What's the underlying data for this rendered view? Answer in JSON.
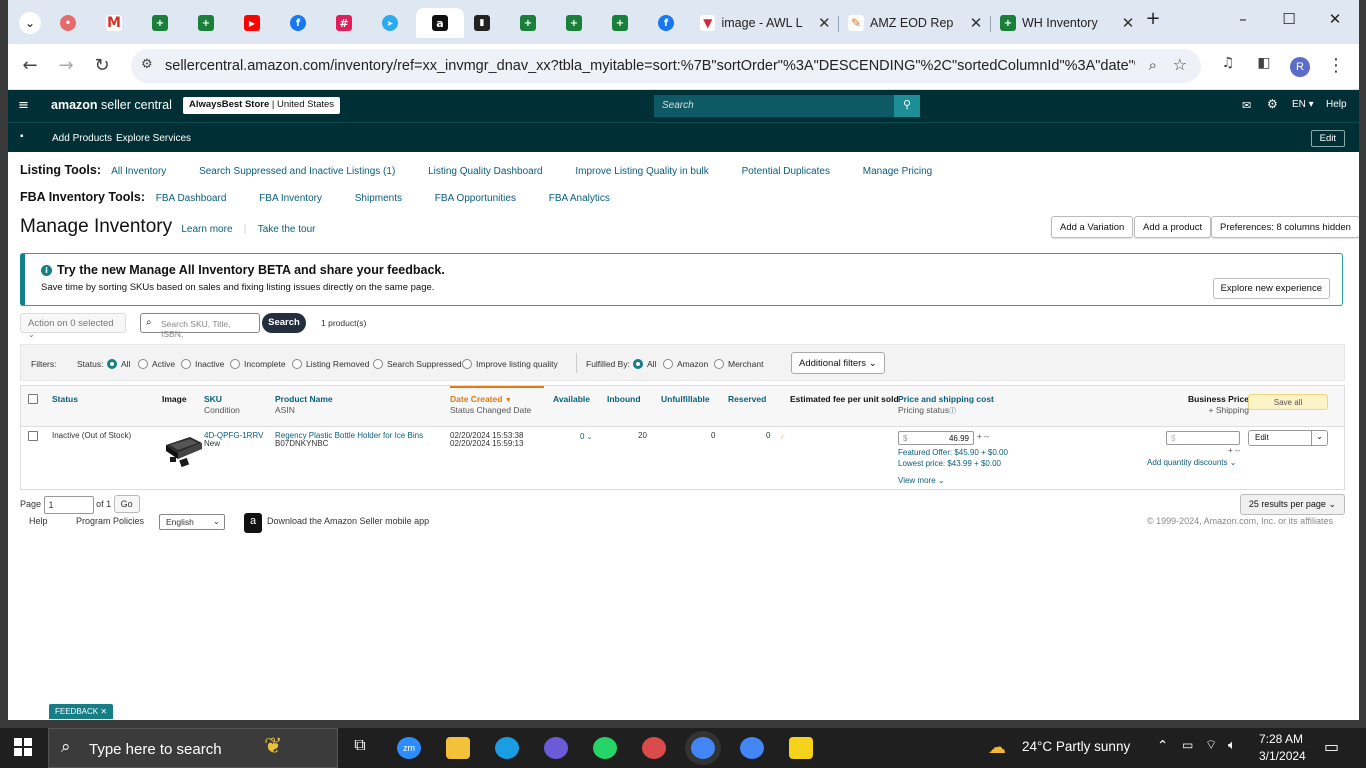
{
  "browser": {
    "tabs": [
      {
        "label": "image - AWL L",
        "close": "✕"
      },
      {
        "label": "AMZ EOD Rep",
        "close": "✕"
      },
      {
        "label": "WH Inventory",
        "close": "✕"
      }
    ],
    "new_tab": "+",
    "url": "sellercentral.amazon.com/inventory/ref=xx_invmgr_dnav_xx?tbla_myitable=sort:%7B\"sortOrder\"%3A\"DESCENDING\"%2C\"sortedColumnId\"%3A\"date\"%7D;s...",
    "profile_initial": "R"
  },
  "header": {
    "logo_bold": "amazon",
    "logo_rest": " seller central",
    "store": "AlwaysBest Store",
    "region": "United States",
    "search_placeholder": "Search",
    "lang": "EN ▾",
    "help": "Help",
    "nav": [
      "Add Products",
      "Explore Services"
    ],
    "edit": "Edit"
  },
  "listing_tools": {
    "label": "Listing Tools:",
    "links": [
      "All Inventory",
      "Search Suppressed and Inactive Listings (1)",
      "Listing Quality Dashboard",
      "Improve Listing Quality in bulk",
      "Potential Duplicates",
      "Manage Pricing"
    ]
  },
  "fba_tools": {
    "label": "FBA Inventory Tools:",
    "links": [
      "FBA Dashboard",
      "FBA Inventory",
      "Shipments",
      "FBA Opportunities",
      "FBA Analytics"
    ]
  },
  "page": {
    "title": "Manage Inventory",
    "learn_more": "Learn more",
    "tour": "Take the tour",
    "buttons": [
      "Add a Variation",
      "Add a product",
      "Preferences: 8 columns hidden"
    ]
  },
  "banner": {
    "heading": "Try the new Manage All Inventory BETA and share your feedback.",
    "text": "Save time by sorting SKUs based on sales and fixing listing issues directly on the same page.",
    "button": "Explore new experience"
  },
  "actions": {
    "action_select": "Action on 0 selected",
    "search_placeholder": "Search SKU, Title, ISBN,",
    "search_button": "Search",
    "count": "1 product(s)"
  },
  "filters": {
    "label": "Filters:",
    "status_label": "Status:",
    "status_options": [
      "All",
      "Active",
      "Inactive",
      "Incomplete",
      "Listing Removed",
      "Search Suppressed",
      "Improve listing quality"
    ],
    "fulfilled_label": "Fulfilled By:",
    "fulfilled_options": [
      "All",
      "Amazon",
      "Merchant"
    ],
    "additional": "Additional filters"
  },
  "table": {
    "headers": {
      "status": "Status",
      "image": "Image",
      "sku": "SKU",
      "sku_sub": "Condition",
      "product": "Product Name",
      "product_sub": "ASIN",
      "date": "Date Created",
      "date_sub": "Status Changed Date",
      "available": "Available",
      "inbound": "Inbound",
      "unfulfillable": "Unfulfillable",
      "reserved": "Reserved",
      "fee": "Estimated fee per unit sold",
      "price": "Price and shipping cost",
      "price_sub": "Pricing status",
      "business": "Business Price",
      "business_sub": "+ Shipping",
      "save_all": "Save all"
    },
    "row": {
      "status": "Inactive (Out of Stock)",
      "sku": "4D-QPFG-1RRV",
      "condition": "New",
      "product": "Regency Plastic Bottle Holder for Ice Bins",
      "asin": "B07DNKYNBC",
      "created": "02/20/2024 15:53:38",
      "changed": "02/20/2024 15:59:13",
      "available": "0",
      "inbound": "20",
      "unfulfillable": "0",
      "reserved": "0",
      "price_currency": "$",
      "price": "46.99",
      "featured": "Featured Offer: $45.90 + $0.00",
      "lowest": "Lowest price: $43.99 + $0.00",
      "view_more": "View more",
      "business_currency": "$",
      "quantity_discounts": "Add quantity discounts",
      "edit": "Edit"
    }
  },
  "pager": {
    "page_label": "Page",
    "page": "1",
    "of": "of 1",
    "go": "Go",
    "per_page": "25 results per page"
  },
  "footer": {
    "help": "Help",
    "policies": "Program Policies",
    "language": "English",
    "app": "Download the Amazon Seller mobile app",
    "copyright": "© 1999-2024, Amazon.com, Inc. or its affiliates"
  },
  "feedback": "FEEDBACK ✕",
  "taskbar": {
    "search": "Type here to search",
    "weather": "24°C  Partly sunny",
    "time": "7:28 AM",
    "date": "3/1/2024"
  }
}
